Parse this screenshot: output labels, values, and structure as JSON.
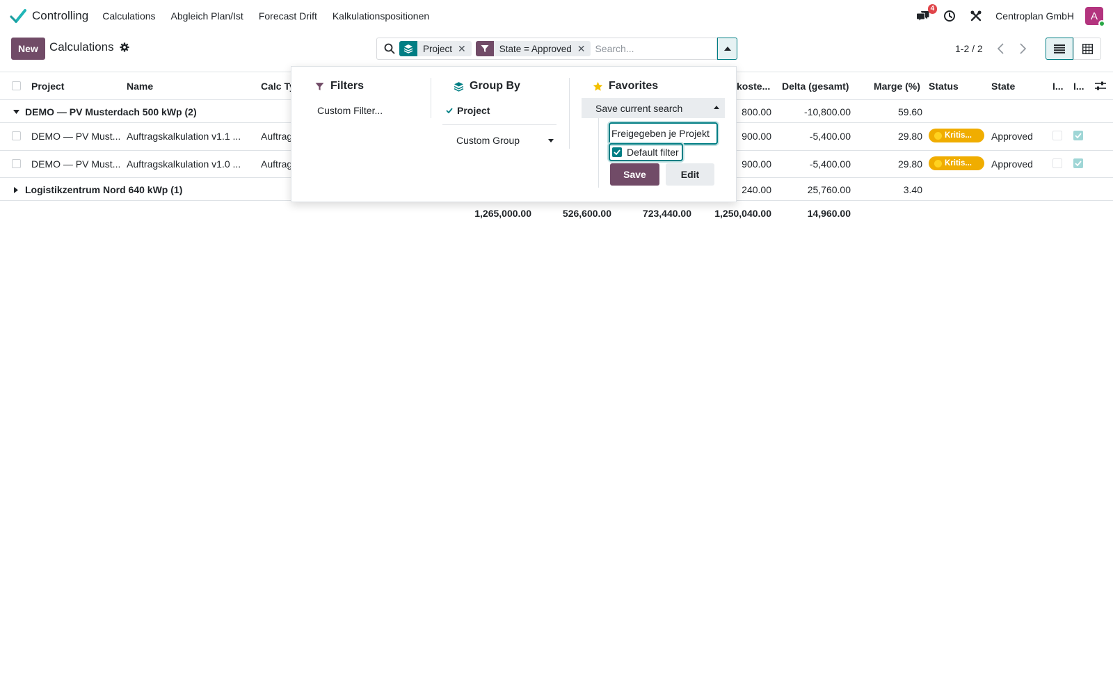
{
  "navbar": {
    "app_name": "Controlling",
    "menu": [
      "Calculations",
      "Abgleich Plan/Ist",
      "Forecast Drift",
      "Kalkulationspositionen"
    ],
    "message_count": "4",
    "company": "Centroplan GmbH",
    "avatar_letter": "A"
  },
  "control": {
    "new_label": "New",
    "title": "Calculations",
    "pager": "1-2 / 2"
  },
  "search": {
    "facets": [
      {
        "icon": "layers-icon",
        "label": "Project"
      },
      {
        "icon": "filter-icon",
        "label": "State = Approved"
      }
    ],
    "placeholder": "Search..."
  },
  "table": {
    "headers": {
      "project": "Project",
      "name": "Name",
      "calc_type": "Calc Ty",
      "kosten": "koste...",
      "delta": "Delta (gesamt)",
      "marge": "Marge (%)",
      "status": "Status",
      "state": "State",
      "col_i1": "I...",
      "col_i2": "I..."
    },
    "groups": [
      {
        "label": "DEMO — PV Musterdach 500 kWp (2)",
        "expanded": true,
        "kosten": "800.00",
        "delta": "-10,800.00",
        "marge": "59.60",
        "rows": [
          {
            "project": "DEMO — PV Must...",
            "name": "Auftragskalkulation v1.1 ...",
            "calc_type": "Auftrag",
            "kosten": "900.00",
            "delta": "-5,400.00",
            "marge": "29.80",
            "status": "Kritis...",
            "state": "Approved",
            "i1": false,
            "i2": true
          },
          {
            "project": "DEMO — PV Must...",
            "name": "Auftragskalkulation v1.0 ...",
            "calc_type": "Auftrag",
            "kosten": "900.00",
            "delta": "-5,400.00",
            "marge": "29.80",
            "status": "Kritis...",
            "state": "Approved",
            "i1": false,
            "i2": true
          }
        ]
      },
      {
        "label": "Logistikzentrum Nord 640 kWp (1)",
        "expanded": false,
        "kosten": "240.00",
        "delta": "25,760.00",
        "marge": "3.40",
        "rows": []
      }
    ],
    "totals": [
      "1,265,000.00",
      "526,600.00",
      "723,440.00",
      "1,250,040.00",
      "14,960.00"
    ]
  },
  "dropdown": {
    "filters": {
      "title": "Filters",
      "items": [
        "Custom Filter..."
      ]
    },
    "groupby": {
      "title": "Group By",
      "items": [
        "Project"
      ],
      "custom_group": "Custom Group"
    },
    "favorites": {
      "title": "Favorites",
      "save_current": "Save current search",
      "name_value": "Freigegeben je Projekt",
      "default_filter_label": "Default filter",
      "default_filter_checked": true,
      "save_label": "Save",
      "edit_label": "Edit"
    }
  },
  "colors": {
    "primary": "#714b67",
    "accent": "#017e84",
    "warning": "#f0ad00",
    "badge": "#e0454a"
  }
}
